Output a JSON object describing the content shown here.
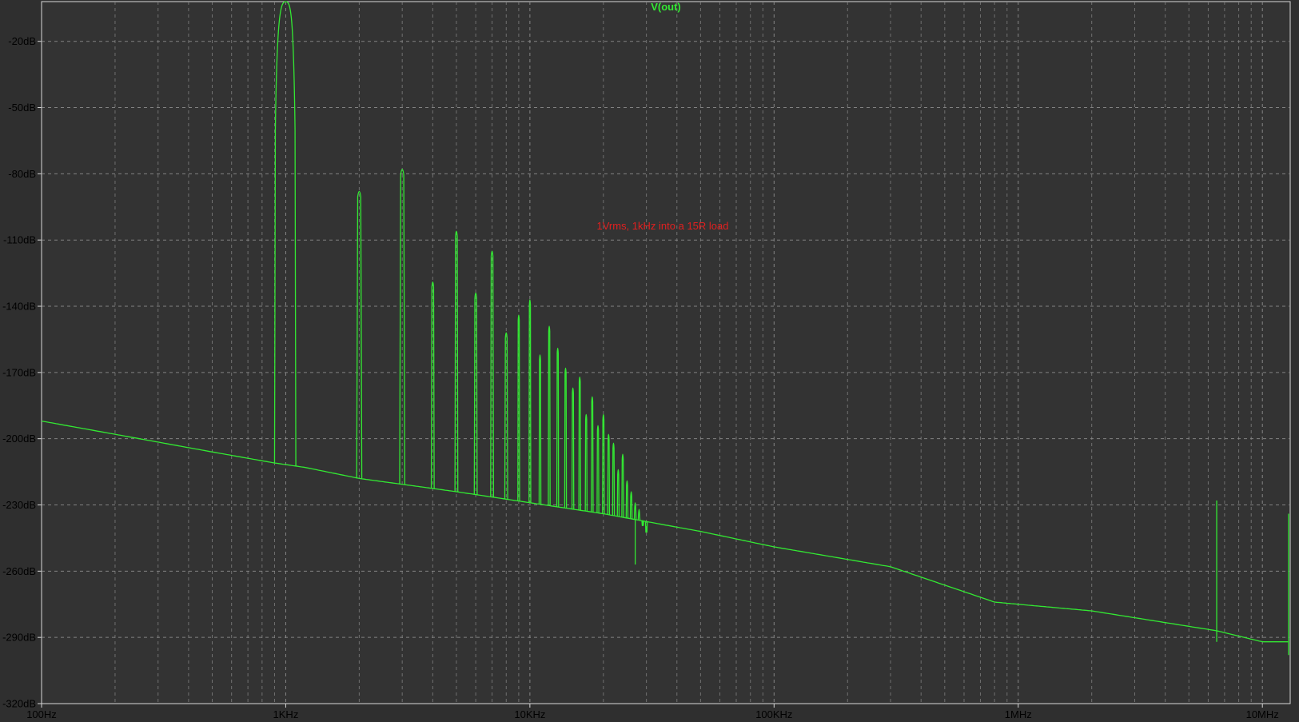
{
  "colors": {
    "background": "#2f2f2f",
    "plot_background": "#333333",
    "axis": "#d8d8d8",
    "grid": "#8a8a8a",
    "trace": "#33e833",
    "tick_text": "#000000",
    "annotation": "#e02020"
  },
  "chart_data": {
    "type": "line",
    "title": "V(out)",
    "x_scale": "log",
    "xlim": [
      100,
      13000000
    ],
    "ylim": [
      -320,
      -2
    ],
    "grid": true,
    "x_ticks": [
      {
        "value": 100,
        "label": "100Hz"
      },
      {
        "value": 1000,
        "label": "1KHz"
      },
      {
        "value": 10000,
        "label": "10KHz"
      },
      {
        "value": 100000,
        "label": "100KHz"
      },
      {
        "value": 1000000,
        "label": "1MHz"
      },
      {
        "value": 10000000,
        "label": "10MHz"
      }
    ],
    "y_ticks": [
      {
        "value": -20,
        "label": "-20dB"
      },
      {
        "value": -50,
        "label": "-50dB"
      },
      {
        "value": -80,
        "label": "-80dB"
      },
      {
        "value": -110,
        "label": "-110dB"
      },
      {
        "value": -140,
        "label": "-140dB"
      },
      {
        "value": -170,
        "label": "-170dB"
      },
      {
        "value": -200,
        "label": "-200dB"
      },
      {
        "value": -230,
        "label": "-230dB"
      },
      {
        "value": -260,
        "label": "-260dB"
      },
      {
        "value": -290,
        "label": "-290dB"
      },
      {
        "value": -320,
        "label": "-320dB"
      }
    ],
    "annotations": [
      {
        "text": "1Vrms, 1kHz into a 15R load",
        "x": 30000,
        "y": -100
      }
    ],
    "noise_floor": {
      "x": [
        100,
        200,
        500,
        900,
        1200,
        2000,
        5000,
        10000,
        20000,
        50000,
        100000,
        300000,
        800000,
        1000000,
        2000000,
        6500000,
        10000000,
        13000000
      ],
      "y": [
        -192,
        -198,
        -206,
        -211,
        -213,
        -218,
        -224,
        -229,
        -234,
        -242,
        -249,
        -258,
        -274,
        -275,
        -278,
        -287,
        -292,
        -292
      ]
    },
    "fundamental": {
      "x": 1000,
      "y": -2
    },
    "harmonics": [
      {
        "n": 2,
        "y": -86
      },
      {
        "n": 3,
        "y": -76
      },
      {
        "n": 4,
        "y": -127
      },
      {
        "n": 5,
        "y": -104
      },
      {
        "n": 6,
        "y": -132
      },
      {
        "n": 7,
        "y": -113
      },
      {
        "n": 8,
        "y": -150
      },
      {
        "n": 9,
        "y": -142
      },
      {
        "n": 10,
        "y": -135
      },
      {
        "n": 11,
        "y": -160
      },
      {
        "n": 12,
        "y": -147
      },
      {
        "n": 13,
        "y": -157
      },
      {
        "n": 14,
        "y": -166
      },
      {
        "n": 15,
        "y": -175
      },
      {
        "n": 16,
        "y": -170
      },
      {
        "n": 17,
        "y": -187
      },
      {
        "n": 18,
        "y": -179
      },
      {
        "n": 19,
        "y": -192
      },
      {
        "n": 20,
        "y": -187
      },
      {
        "n": 21,
        "y": -196
      },
      {
        "n": 22,
        "y": -200
      },
      {
        "n": 23,
        "y": -212
      },
      {
        "n": 24,
        "y": -205
      },
      {
        "n": 25,
        "y": -217
      },
      {
        "n": 26,
        "y": -222
      },
      {
        "n": 27,
        "y": -227
      },
      {
        "n": 28,
        "y": -230
      },
      {
        "n": 29,
        "y": -235
      },
      {
        "n": 30,
        "y": -238
      }
    ],
    "dips": [
      {
        "x": 27000,
        "y": -257
      }
    ],
    "spurs": [
      {
        "x": 6500000,
        "y": -228,
        "low": -292
      },
      {
        "x": 12800000,
        "y": -234,
        "low": -298
      }
    ]
  }
}
